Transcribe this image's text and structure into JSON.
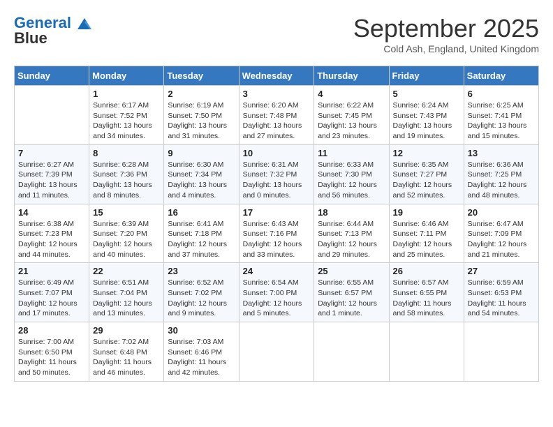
{
  "header": {
    "logo_line1": "General",
    "logo_line2": "Blue",
    "month": "September 2025",
    "location": "Cold Ash, England, United Kingdom"
  },
  "days_of_week": [
    "Sunday",
    "Monday",
    "Tuesday",
    "Wednesday",
    "Thursday",
    "Friday",
    "Saturday"
  ],
  "weeks": [
    [
      {
        "day": "",
        "info": ""
      },
      {
        "day": "1",
        "info": "Sunrise: 6:17 AM\nSunset: 7:52 PM\nDaylight: 13 hours\nand 34 minutes."
      },
      {
        "day": "2",
        "info": "Sunrise: 6:19 AM\nSunset: 7:50 PM\nDaylight: 13 hours\nand 31 minutes."
      },
      {
        "day": "3",
        "info": "Sunrise: 6:20 AM\nSunset: 7:48 PM\nDaylight: 13 hours\nand 27 minutes."
      },
      {
        "day": "4",
        "info": "Sunrise: 6:22 AM\nSunset: 7:45 PM\nDaylight: 13 hours\nand 23 minutes."
      },
      {
        "day": "5",
        "info": "Sunrise: 6:24 AM\nSunset: 7:43 PM\nDaylight: 13 hours\nand 19 minutes."
      },
      {
        "day": "6",
        "info": "Sunrise: 6:25 AM\nSunset: 7:41 PM\nDaylight: 13 hours\nand 15 minutes."
      }
    ],
    [
      {
        "day": "7",
        "info": "Sunrise: 6:27 AM\nSunset: 7:39 PM\nDaylight: 13 hours\nand 11 minutes."
      },
      {
        "day": "8",
        "info": "Sunrise: 6:28 AM\nSunset: 7:36 PM\nDaylight: 13 hours\nand 8 minutes."
      },
      {
        "day": "9",
        "info": "Sunrise: 6:30 AM\nSunset: 7:34 PM\nDaylight: 13 hours\nand 4 minutes."
      },
      {
        "day": "10",
        "info": "Sunrise: 6:31 AM\nSunset: 7:32 PM\nDaylight: 13 hours\nand 0 minutes."
      },
      {
        "day": "11",
        "info": "Sunrise: 6:33 AM\nSunset: 7:30 PM\nDaylight: 12 hours\nand 56 minutes."
      },
      {
        "day": "12",
        "info": "Sunrise: 6:35 AM\nSunset: 7:27 PM\nDaylight: 12 hours\nand 52 minutes."
      },
      {
        "day": "13",
        "info": "Sunrise: 6:36 AM\nSunset: 7:25 PM\nDaylight: 12 hours\nand 48 minutes."
      }
    ],
    [
      {
        "day": "14",
        "info": "Sunrise: 6:38 AM\nSunset: 7:23 PM\nDaylight: 12 hours\nand 44 minutes."
      },
      {
        "day": "15",
        "info": "Sunrise: 6:39 AM\nSunset: 7:20 PM\nDaylight: 12 hours\nand 40 minutes."
      },
      {
        "day": "16",
        "info": "Sunrise: 6:41 AM\nSunset: 7:18 PM\nDaylight: 12 hours\nand 37 minutes."
      },
      {
        "day": "17",
        "info": "Sunrise: 6:43 AM\nSunset: 7:16 PM\nDaylight: 12 hours\nand 33 minutes."
      },
      {
        "day": "18",
        "info": "Sunrise: 6:44 AM\nSunset: 7:13 PM\nDaylight: 12 hours\nand 29 minutes."
      },
      {
        "day": "19",
        "info": "Sunrise: 6:46 AM\nSunset: 7:11 PM\nDaylight: 12 hours\nand 25 minutes."
      },
      {
        "day": "20",
        "info": "Sunrise: 6:47 AM\nSunset: 7:09 PM\nDaylight: 12 hours\nand 21 minutes."
      }
    ],
    [
      {
        "day": "21",
        "info": "Sunrise: 6:49 AM\nSunset: 7:07 PM\nDaylight: 12 hours\nand 17 minutes."
      },
      {
        "day": "22",
        "info": "Sunrise: 6:51 AM\nSunset: 7:04 PM\nDaylight: 12 hours\nand 13 minutes."
      },
      {
        "day": "23",
        "info": "Sunrise: 6:52 AM\nSunset: 7:02 PM\nDaylight: 12 hours\nand 9 minutes."
      },
      {
        "day": "24",
        "info": "Sunrise: 6:54 AM\nSunset: 7:00 PM\nDaylight: 12 hours\nand 5 minutes."
      },
      {
        "day": "25",
        "info": "Sunrise: 6:55 AM\nSunset: 6:57 PM\nDaylight: 12 hours\nand 1 minute."
      },
      {
        "day": "26",
        "info": "Sunrise: 6:57 AM\nSunset: 6:55 PM\nDaylight: 11 hours\nand 58 minutes."
      },
      {
        "day": "27",
        "info": "Sunrise: 6:59 AM\nSunset: 6:53 PM\nDaylight: 11 hours\nand 54 minutes."
      }
    ],
    [
      {
        "day": "28",
        "info": "Sunrise: 7:00 AM\nSunset: 6:50 PM\nDaylight: 11 hours\nand 50 minutes."
      },
      {
        "day": "29",
        "info": "Sunrise: 7:02 AM\nSunset: 6:48 PM\nDaylight: 11 hours\nand 46 minutes."
      },
      {
        "day": "30",
        "info": "Sunrise: 7:03 AM\nSunset: 6:46 PM\nDaylight: 11 hours\nand 42 minutes."
      },
      {
        "day": "",
        "info": ""
      },
      {
        "day": "",
        "info": ""
      },
      {
        "day": "",
        "info": ""
      },
      {
        "day": "",
        "info": ""
      }
    ]
  ]
}
